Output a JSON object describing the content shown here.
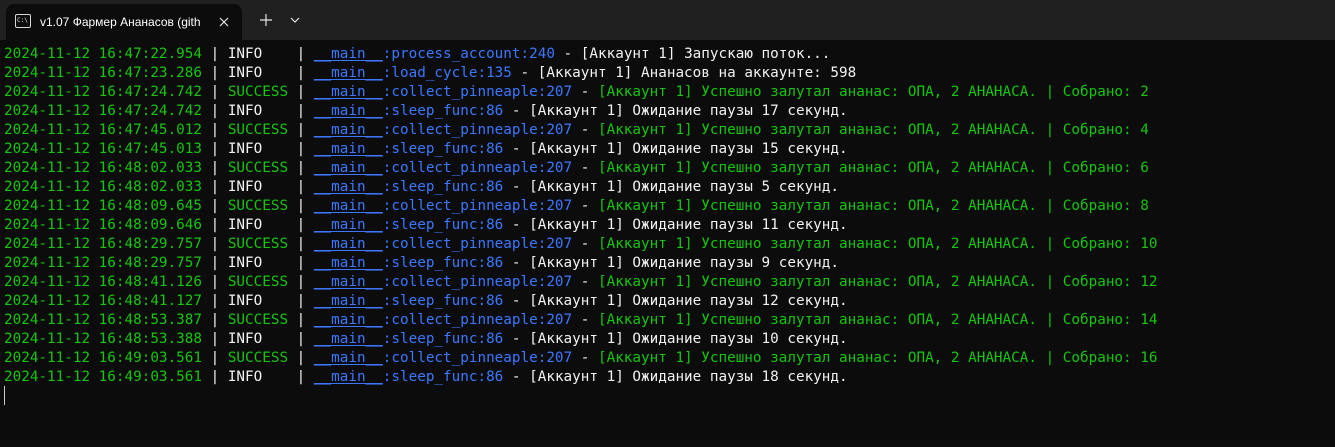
{
  "window": {
    "tab_title": "v1.07 Фармер Ананасов (gith",
    "tab_icon_text": "C:\\",
    "icons": {
      "tab_icon": "terminal-icon",
      "close": "close-icon",
      "new_tab": "plus-icon",
      "dropdown": "chevron-down-icon"
    }
  },
  "colors": {
    "background": "#0c0c0c",
    "titlebar": "#202020",
    "green": "#16c60c",
    "blue": "#3b78ff",
    "white": "#f2f2f2"
  },
  "log": [
    {
      "time": "2024-11-12 16:47:22.954",
      "level": "INFO   ",
      "module": "__main__",
      "func": "process_account",
      "line": "240",
      "message": "[Аккаунт 1] Запускаю поток..."
    },
    {
      "time": "2024-11-12 16:47:23.286",
      "level": "INFO   ",
      "module": "__main__",
      "func": "load_cycle",
      "line": "135",
      "message": "[Аккаунт 1] Ананасов на аккаунте: 598"
    },
    {
      "time": "2024-11-12 16:47:24.742",
      "level": "SUCCESS",
      "module": "__main__",
      "func": "collect_pinneaple",
      "line": "207",
      "message": "[Аккаунт 1] Успешно залутал ананас: ОПА, 2 АНАНАСА. | Собрано: 2"
    },
    {
      "time": "2024-11-12 16:47:24.742",
      "level": "INFO   ",
      "module": "__main__",
      "func": "sleep_func",
      "line": "86",
      "message": "[Аккаунт 1] Ожидание паузы 17 секунд."
    },
    {
      "time": "2024-11-12 16:47:45.012",
      "level": "SUCCESS",
      "module": "__main__",
      "func": "collect_pinneaple",
      "line": "207",
      "message": "[Аккаунт 1] Успешно залутал ананас: ОПА, 2 АНАНАСА. | Собрано: 4"
    },
    {
      "time": "2024-11-12 16:47:45.013",
      "level": "INFO   ",
      "module": "__main__",
      "func": "sleep_func",
      "line": "86",
      "message": "[Аккаунт 1] Ожидание паузы 15 секунд."
    },
    {
      "time": "2024-11-12 16:48:02.033",
      "level": "SUCCESS",
      "module": "__main__",
      "func": "collect_pinneaple",
      "line": "207",
      "message": "[Аккаунт 1] Успешно залутал ананас: ОПА, 2 АНАНАСА. | Собрано: 6"
    },
    {
      "time": "2024-11-12 16:48:02.033",
      "level": "INFO   ",
      "module": "__main__",
      "func": "sleep_func",
      "line": "86",
      "message": "[Аккаунт 1] Ожидание паузы 5 секунд."
    },
    {
      "time": "2024-11-12 16:48:09.645",
      "level": "SUCCESS",
      "module": "__main__",
      "func": "collect_pinneaple",
      "line": "207",
      "message": "[Аккаунт 1] Успешно залутал ананас: ОПА, 2 АНАНАСА. | Собрано: 8"
    },
    {
      "time": "2024-11-12 16:48:09.646",
      "level": "INFO   ",
      "module": "__main__",
      "func": "sleep_func",
      "line": "86",
      "message": "[Аккаунт 1] Ожидание паузы 11 секунд."
    },
    {
      "time": "2024-11-12 16:48:29.757",
      "level": "SUCCESS",
      "module": "__main__",
      "func": "collect_pinneaple",
      "line": "207",
      "message": "[Аккаунт 1] Успешно залутал ананас: ОПА, 2 АНАНАСА. | Собрано: 10"
    },
    {
      "time": "2024-11-12 16:48:29.757",
      "level": "INFO   ",
      "module": "__main__",
      "func": "sleep_func",
      "line": "86",
      "message": "[Аккаунт 1] Ожидание паузы 9 секунд."
    },
    {
      "time": "2024-11-12 16:48:41.126",
      "level": "SUCCESS",
      "module": "__main__",
      "func": "collect_pinneaple",
      "line": "207",
      "message": "[Аккаунт 1] Успешно залутал ананас: ОПА, 2 АНАНАСА. | Собрано: 12"
    },
    {
      "time": "2024-11-12 16:48:41.127",
      "level": "INFO   ",
      "module": "__main__",
      "func": "sleep_func",
      "line": "86",
      "message": "[Аккаунт 1] Ожидание паузы 12 секунд."
    },
    {
      "time": "2024-11-12 16:48:53.387",
      "level": "SUCCESS",
      "module": "__main__",
      "func": "collect_pinneaple",
      "line": "207",
      "message": "[Аккаунт 1] Успешно залутал ананас: ОПА, 2 АНАНАСА. | Собрано: 14"
    },
    {
      "time": "2024-11-12 16:48:53.388",
      "level": "INFO   ",
      "module": "__main__",
      "func": "sleep_func",
      "line": "86",
      "message": "[Аккаунт 1] Ожидание паузы 10 секунд."
    },
    {
      "time": "2024-11-12 16:49:03.561",
      "level": "SUCCESS",
      "module": "__main__",
      "func": "collect_pinneaple",
      "line": "207",
      "message": "[Аккаунт 1] Успешно залутал ананас: ОПА, 2 АНАНАСА. | Собрано: 16"
    },
    {
      "time": "2024-11-12 16:49:03.561",
      "level": "INFO   ",
      "module": "__main__",
      "func": "sleep_func",
      "line": "86",
      "message": "[Аккаунт 1] Ожидание паузы 18 секунд."
    }
  ]
}
